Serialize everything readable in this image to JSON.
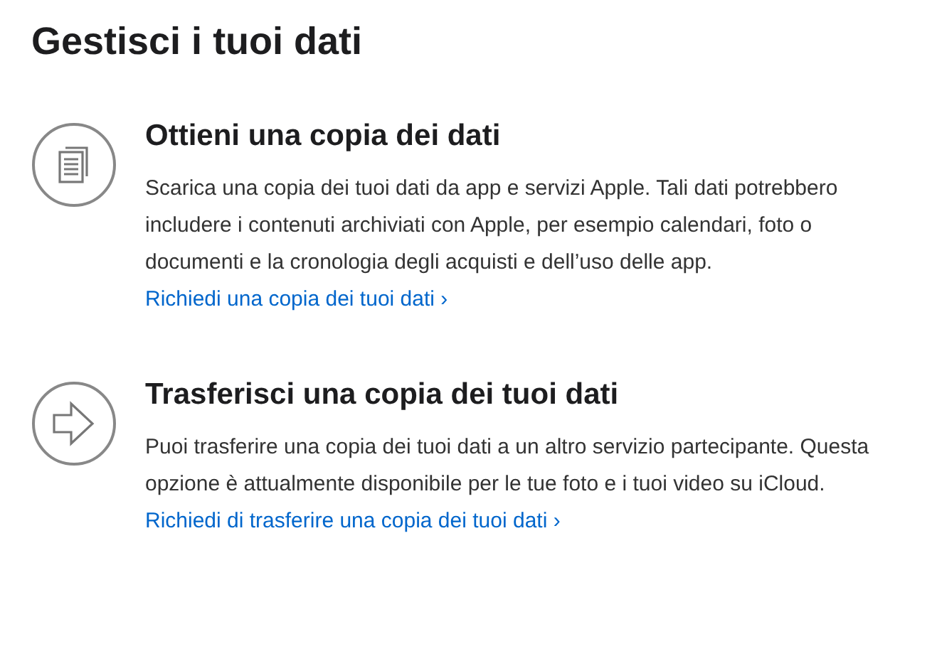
{
  "title": "Gestisci i tuoi dati",
  "sections": [
    {
      "kind": "documents",
      "heading": "Ottieni una copia dei dati",
      "body": "Scarica una copia dei tuoi dati da app e servizi Apple. Tali dati potrebbero includere i contenuti archiviati con Apple, per esempio calendari, foto o documenti e la cronologia degli acquisti e dell’uso delle app.",
      "link": "Richiedi una copia dei tuoi dati ›"
    },
    {
      "kind": "arrow",
      "heading": "Trasferisci una copia dei tuoi dati",
      "body": "Puoi trasferire una copia dei tuoi dati a un altro servizio partecipante. Questa opzione è attualmente disponibile per le tue foto e i tuoi video su iCloud.",
      "link": "Richiedi di trasferire una copia dei tuoi dati ›"
    }
  ]
}
